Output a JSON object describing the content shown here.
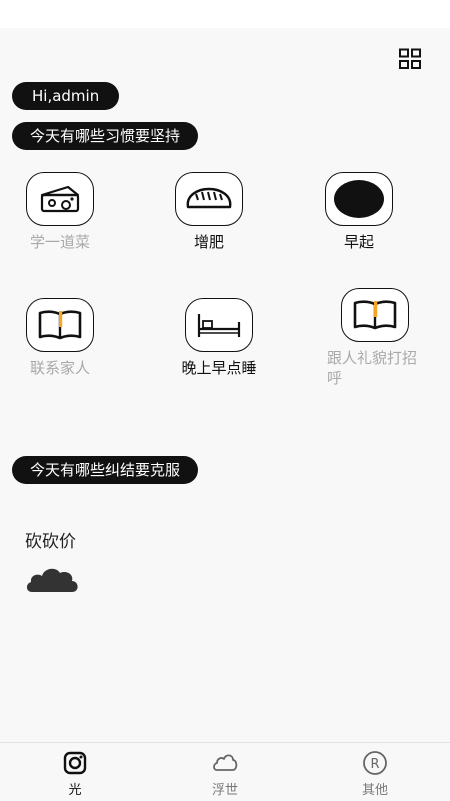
{
  "greeting": "Hi,admin",
  "habits_section": {
    "title": "今天有哪些习惯要坚持",
    "items": [
      {
        "label": "学一道菜",
        "icon": "cheese-icon",
        "done": false
      },
      {
        "label": "增肥",
        "icon": "bread-icon",
        "done": true
      },
      {
        "label": "早起",
        "icon": "black-circle-icon",
        "done": true
      },
      {
        "label": "联系家人",
        "icon": "book-icon",
        "done": false
      },
      {
        "label": "晚上早点睡",
        "icon": "bed-icon",
        "done": true
      },
      {
        "label": "跟人礼貌打招呼",
        "icon": "book-icon",
        "done": false
      }
    ]
  },
  "struggles_section": {
    "title": "今天有哪些纠结要克服",
    "items": [
      {
        "label": "砍砍价",
        "icon": "cloud-icon"
      }
    ]
  },
  "tabbar": {
    "tabs": [
      {
        "label": "光",
        "icon": "camera-icon",
        "active": true
      },
      {
        "label": "浮世",
        "icon": "cloud-outline-icon",
        "active": false
      },
      {
        "label": "其他",
        "icon": "registered-icon",
        "active": false
      }
    ]
  },
  "colors": {
    "background": "#f8f8f8",
    "pill": "#111111",
    "pending_text": "#a9a9a9",
    "accent_yellow": "#f5a623"
  }
}
